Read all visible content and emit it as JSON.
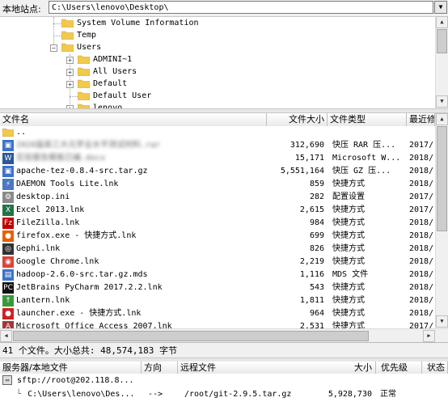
{
  "path_bar": {
    "label": "本地站点:",
    "path": "C:\\Users\\lenovo\\Desktop\\",
    "dropdown_glyph": "▼"
  },
  "tree": {
    "items": [
      {
        "label": "System Volume Information"
      },
      {
        "label": "Temp"
      },
      {
        "label": "Users"
      },
      {
        "label": "ADMINI~1"
      },
      {
        "label": "All Users"
      },
      {
        "label": "Default"
      },
      {
        "label": "Default User"
      },
      {
        "label": "lenovo"
      }
    ]
  },
  "file_list": {
    "columns": {
      "name": "文件名",
      "size": "文件大小",
      "type": "文件类型",
      "modified": "最近修"
    },
    "rows": [
      {
        "name": "..",
        "size": "",
        "type": "",
        "modified": "",
        "icon": "folder-icon",
        "color": "#f2c94c"
      },
      {
        "name": "2020届高三大元学业水平测试材料.rar",
        "size": "312,690",
        "type": "快压 RAR 压...",
        "modified": "2017/",
        "icon": "archive-icon",
        "color": "#3b73c9"
      },
      {
        "name": "实验报告模板已编.docx",
        "size": "15,171",
        "type": "Microsoft W...",
        "modified": "2018/",
        "icon": "word-icon",
        "color": "#2b579a"
      },
      {
        "name": "apache-tez-0.8.4-src.tar.gz",
        "size": "5,551,164",
        "type": "快压 GZ 压...",
        "modified": "2018/",
        "icon": "archive-icon",
        "color": "#3b73c9"
      },
      {
        "name": "DAEMON Tools Lite.lnk",
        "size": "859",
        "type": "快捷方式",
        "modified": "2018/",
        "icon": "daemon-tools-icon",
        "color": "#4a78c2"
      },
      {
        "name": "desktop.ini",
        "size": "282",
        "type": "配置设置",
        "modified": "2017/",
        "icon": "settings-file-icon",
        "color": "#8a8a8a"
      },
      {
        "name": "Excel 2013.lnk",
        "size": "2,615",
        "type": "快捷方式",
        "modified": "2017/",
        "icon": "excel-icon",
        "color": "#217346"
      },
      {
        "name": "FileZilla.lnk",
        "size": "984",
        "type": "快捷方式",
        "modified": "2018/",
        "icon": "filezilla-icon",
        "color": "#bf0000"
      },
      {
        "name": "firefox.exe - 快捷方式.lnk",
        "size": "699",
        "type": "快捷方式",
        "modified": "2018/",
        "icon": "firefox-icon",
        "color": "#e66000"
      },
      {
        "name": "Gephi.lnk",
        "size": "826",
        "type": "快捷方式",
        "modified": "2018/",
        "icon": "gephi-icon",
        "color": "#333333"
      },
      {
        "name": "Google Chrome.lnk",
        "size": "2,219",
        "type": "快捷方式",
        "modified": "2018/",
        "icon": "chrome-icon",
        "color": "#db4437"
      },
      {
        "name": "hadoop-2.6.0-src.tar.gz.mds",
        "size": "1,116",
        "type": "MDS 文件",
        "modified": "2018/",
        "icon": "mds-file-icon",
        "color": "#3b73c9"
      },
      {
        "name": "JetBrains PyCharm 2017.2.2.lnk",
        "size": "543",
        "type": "快捷方式",
        "modified": "2018/",
        "icon": "pycharm-icon",
        "color": "#111111"
      },
      {
        "name": "Lantern.lnk",
        "size": "1,811",
        "type": "快捷方式",
        "modified": "2018/",
        "icon": "lantern-icon",
        "color": "#3a9a3a"
      },
      {
        "name": "launcher.exe - 快捷方式.lnk",
        "size": "964",
        "type": "快捷方式",
        "modified": "2018/",
        "icon": "launcher-icon",
        "color": "#cc2222"
      },
      {
        "name": "Microsoft Office Access 2007.lnk",
        "size": "2,531",
        "type": "快捷方式",
        "modified": "2017/",
        "icon": "access-icon",
        "color": "#a4373a"
      }
    ]
  },
  "status_text": "41 个文件。大小总共: 48,574,183 字节",
  "queue": {
    "columns": {
      "server": "服务器/本地文件",
      "direction": "方向",
      "remote": "远程文件",
      "size": "大小",
      "priority": "优先级",
      "status": "状态"
    },
    "server": "sftp://root@202.118.8...",
    "local_file": "C:\\Users\\lenovo\\Des...",
    "direction": "-->",
    "remote_file": "/root/git-2.9.5.tar.gz",
    "size": "5,928,730",
    "status": "正常"
  },
  "colors": {
    "folder": "#f2c94c",
    "selection": "#cce8ff"
  }
}
